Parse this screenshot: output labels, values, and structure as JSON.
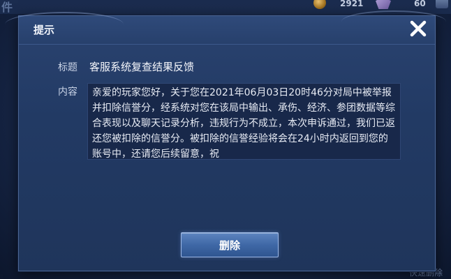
{
  "background": {
    "hud_left_glyph": "件",
    "coin_count": "2921",
    "gem_count": "60",
    "bottom_text": "快速删除"
  },
  "dialog": {
    "title": "提示",
    "subject_label": "标题",
    "subject_value": "客服系统复查结果反馈",
    "content_label": "内容",
    "content_text": "亲爱的玩家您好，关于您在2021年06月03日20时46分对局中被举报并扣除信誉分，经系统对您在该局中输出、承伤、经济、参团数据等综合表现以及聊天记录分析，违规行为不成立，本次申诉通过，我们已返还您被扣除的信誉分。被扣除的信誉经验将会在24小时内返回到您的账号中，还请您后续留意，祝",
    "delete_button_label": "删除"
  },
  "icons": {
    "close": "close-icon",
    "coin": "coin-icon",
    "gem": "gem-icon"
  },
  "colors": {
    "dialog_bg": "#223a64",
    "content_bg": "#18284a",
    "button_accent": "#3f68a6",
    "text_primary": "#f4f6fb",
    "text_label": "#c9d3e6"
  }
}
